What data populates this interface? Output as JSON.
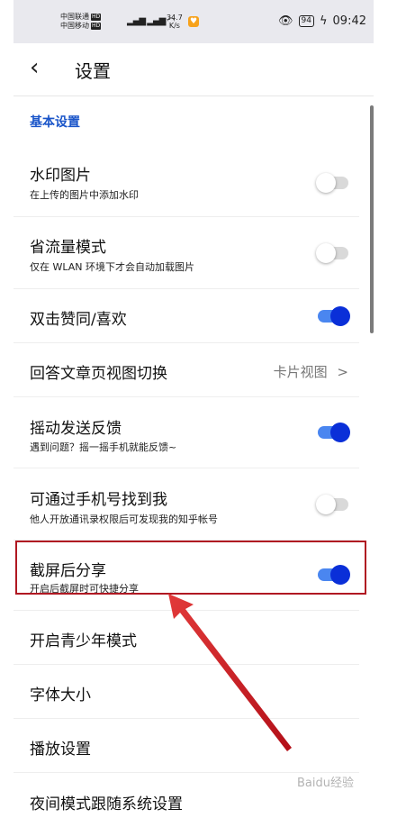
{
  "status_bar": {
    "carrier1": "中国联通",
    "carrier2": "中国移动",
    "hd": "HD",
    "speed_value": "34.7",
    "speed_unit": "K/s",
    "battery": "94",
    "time": "09:42"
  },
  "nav": {
    "back_glyph": "‹",
    "title": "设置"
  },
  "section": {
    "title": "基本设置"
  },
  "rows": [
    {
      "title": "水印图片",
      "subtitle": "在上传的图片中添加水印",
      "toggle": "off"
    },
    {
      "title": "省流量模式",
      "subtitle": "仅在 WLAN 环境下才会自动加载图片",
      "toggle": "off"
    },
    {
      "title": "双击赞同/喜欢",
      "toggle": "on"
    },
    {
      "title": "回答文章页视图切换",
      "value": "卡片视图",
      "chevron": ">"
    },
    {
      "title": "摇动发送反馈",
      "subtitle": "遇到问题？摇一摇手机就能反馈~",
      "toggle": "on"
    },
    {
      "title": "可通过手机号找到我",
      "subtitle": "他人开放通讯录权限后可发现我的知乎帐号",
      "toggle": "off"
    },
    {
      "title": "截屏后分享",
      "subtitle": "开启后截屏时可快捷分享",
      "toggle": "on"
    },
    {
      "title": "开启青少年模式"
    },
    {
      "title": "字体大小"
    },
    {
      "title": "播放设置"
    },
    {
      "title": "夜间模式跟随系统设置"
    }
  ],
  "colors": {
    "accent": "#1a55c9",
    "toggle_on_track": "#4a86f0",
    "toggle_on_knob": "#0a2fd8",
    "highlight": "#b01822"
  },
  "watermark": "Baidu经验"
}
